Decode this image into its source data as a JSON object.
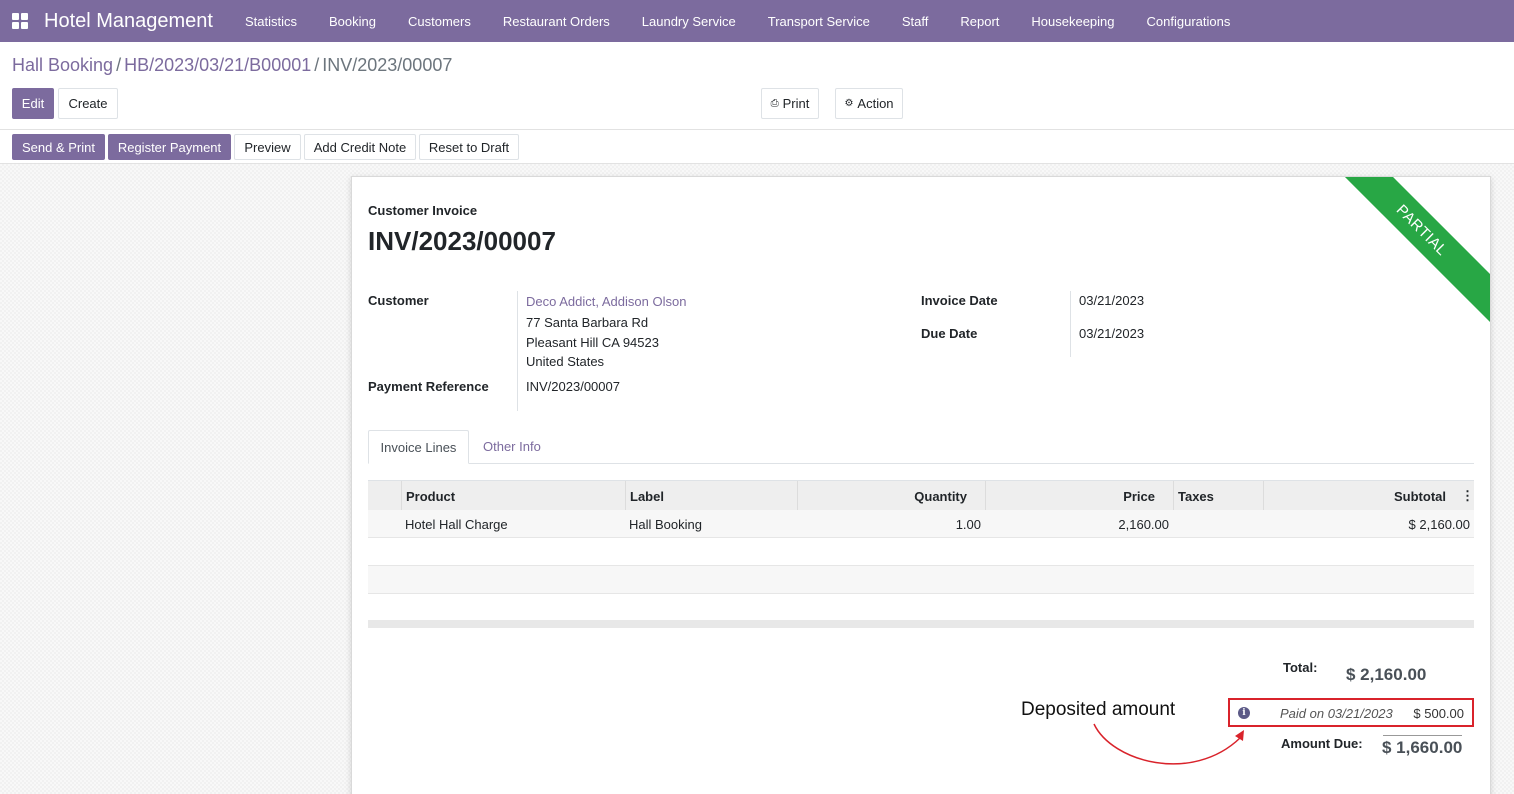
{
  "navbar": {
    "brand": "Hotel Management",
    "menu": [
      "Statistics",
      "Booking",
      "Customers",
      "Restaurant Orders",
      "Laundry Service",
      "Transport Service",
      "Staff",
      "Report",
      "Housekeeping",
      "Configurations"
    ],
    "icon": "apps-grid-icon",
    "color": "#7c6b9e"
  },
  "breadcrumb": {
    "items": [
      "Hall Booking",
      "HB/2023/03/21/B00001"
    ],
    "current": "INV/2023/00007"
  },
  "control": {
    "edit": "Edit",
    "create": "Create",
    "print": "Print",
    "action": "Action",
    "print_icon": "printer-icon",
    "action_icon": "gear-icon"
  },
  "status_bar": {
    "send_print": "Send & Print",
    "register_payment": "Register Payment",
    "preview": "Preview",
    "add_credit_note": "Add Credit Note",
    "reset_draft": "Reset to Draft"
  },
  "invoice": {
    "type": "Customer Invoice",
    "number": "INV/2023/00007",
    "ribbon": "PARTIAL",
    "ribbon_color": "#28a745",
    "customer_label": "Customer",
    "customer_name": "Deco Addict, Addison Olson",
    "address_lines": [
      "77 Santa Barbara Rd",
      "Pleasant Hill CA 94523",
      "United States"
    ],
    "payment_ref_label": "Payment Reference",
    "payment_ref": "INV/2023/00007",
    "invoice_date_label": "Invoice Date",
    "invoice_date": "03/21/2023",
    "due_date_label": "Due Date",
    "due_date": "03/21/2023"
  },
  "tabs": [
    "Invoice Lines",
    "Other Info"
  ],
  "table": {
    "columns": [
      "Product",
      "Label",
      "Quantity",
      "Price",
      "Taxes",
      "Subtotal"
    ],
    "rows": [
      {
        "product": "Hotel Hall Charge",
        "label": "Hall Booking",
        "quantity": "1.00",
        "price": "2,160.00",
        "taxes": "",
        "subtotal": "$ 2,160.00"
      }
    ],
    "options_icon": "vertical-dots-icon"
  },
  "totals": {
    "total_label": "Total:",
    "total": "$ 2,160.00",
    "paid_text": "Paid on 03/21/2023",
    "paid_amount": "$ 500.00",
    "due_label": "Amount Due:",
    "due": "$ 1,660.00",
    "info_icon": "info-circle-icon"
  },
  "annotation": {
    "text": "Deposited amount",
    "color": "#d9232b"
  }
}
